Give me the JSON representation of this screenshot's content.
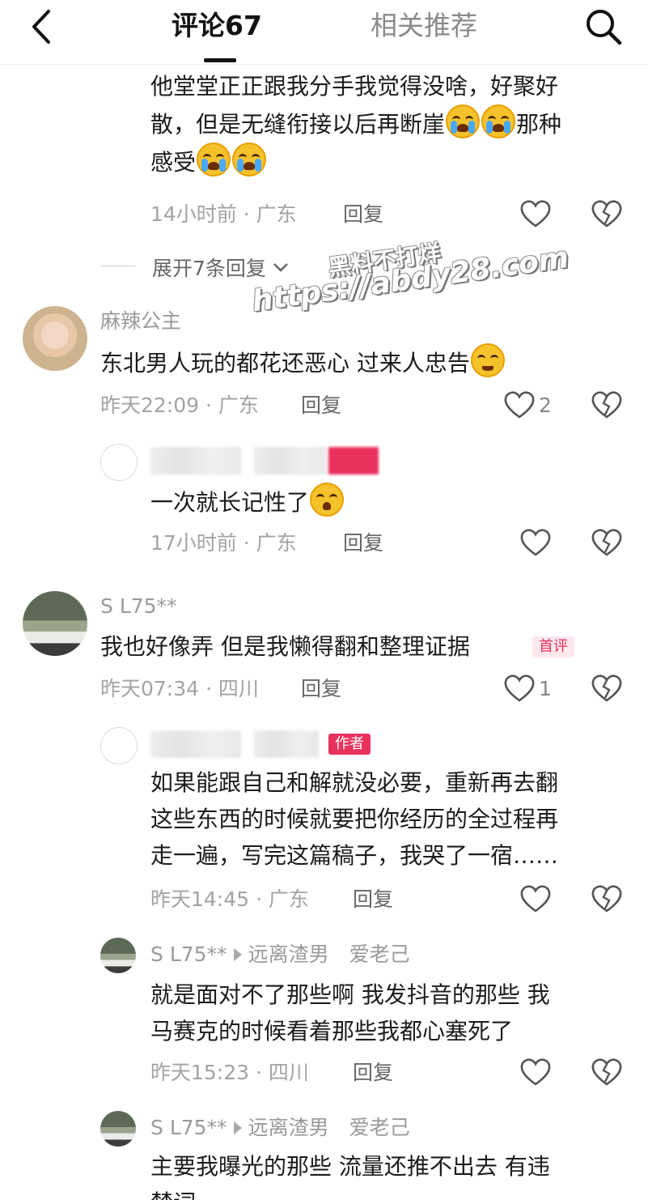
{
  "header": {
    "tab_comments": "评论67",
    "tab_related": "相关推荐"
  },
  "watermark": {
    "line1": "黑料不打烊",
    "line2": "https://abdy28.com"
  },
  "comments": [
    {
      "text_parts": [
        "他堂堂正正跟我分手我觉得没啥，好聚好",
        "散，但是无缝衔接以后再断崖",
        "那种",
        "感受"
      ],
      "time_location": "14小时前 · 广东",
      "reply_label": "回复",
      "expand_label": "展开7条回复"
    },
    {
      "username": "麻辣公主",
      "text": "东北男人玩的都花还恶心 过来人忠告",
      "time_location": "昨天22:09 · 广东",
      "reply_label": "回复",
      "like_count": "2"
    },
    {
      "text": "一次就长记性了",
      "time_location": "17小时前 · 广东",
      "reply_label": "回复"
    },
    {
      "username": "S L75**",
      "text": "我也好像弄 但是我懒得翻和整理证据",
      "badge": "首评",
      "time_location": "昨天07:34 · 四川",
      "reply_label": "回复",
      "like_count": "1"
    },
    {
      "badge": "作者",
      "lines": [
        "如果能跟自己和解就没必要，重新再去翻",
        "这些东西的时候就要把你经历的全过程再",
        "走一遍，写完这篇稿子，我哭了一宿……"
      ],
      "time_location": "昨天14:45 · 广东",
      "reply_label": "回复"
    },
    {
      "username": "S L75**",
      "reply_to": "远离渣男　爱老己",
      "lines": [
        "就是面对不了那些啊 我发抖音的那些 我",
        "马赛克的时候看着那些我都心塞死了"
      ],
      "time_location": "昨天15:23 · 四川",
      "reply_label": "回复"
    },
    {
      "username": "S L75**",
      "reply_to": "远离渣男　爱老己",
      "lines": [
        "主要我曝光的那些 流量还推不出去 有违",
        "禁词"
      ]
    }
  ]
}
